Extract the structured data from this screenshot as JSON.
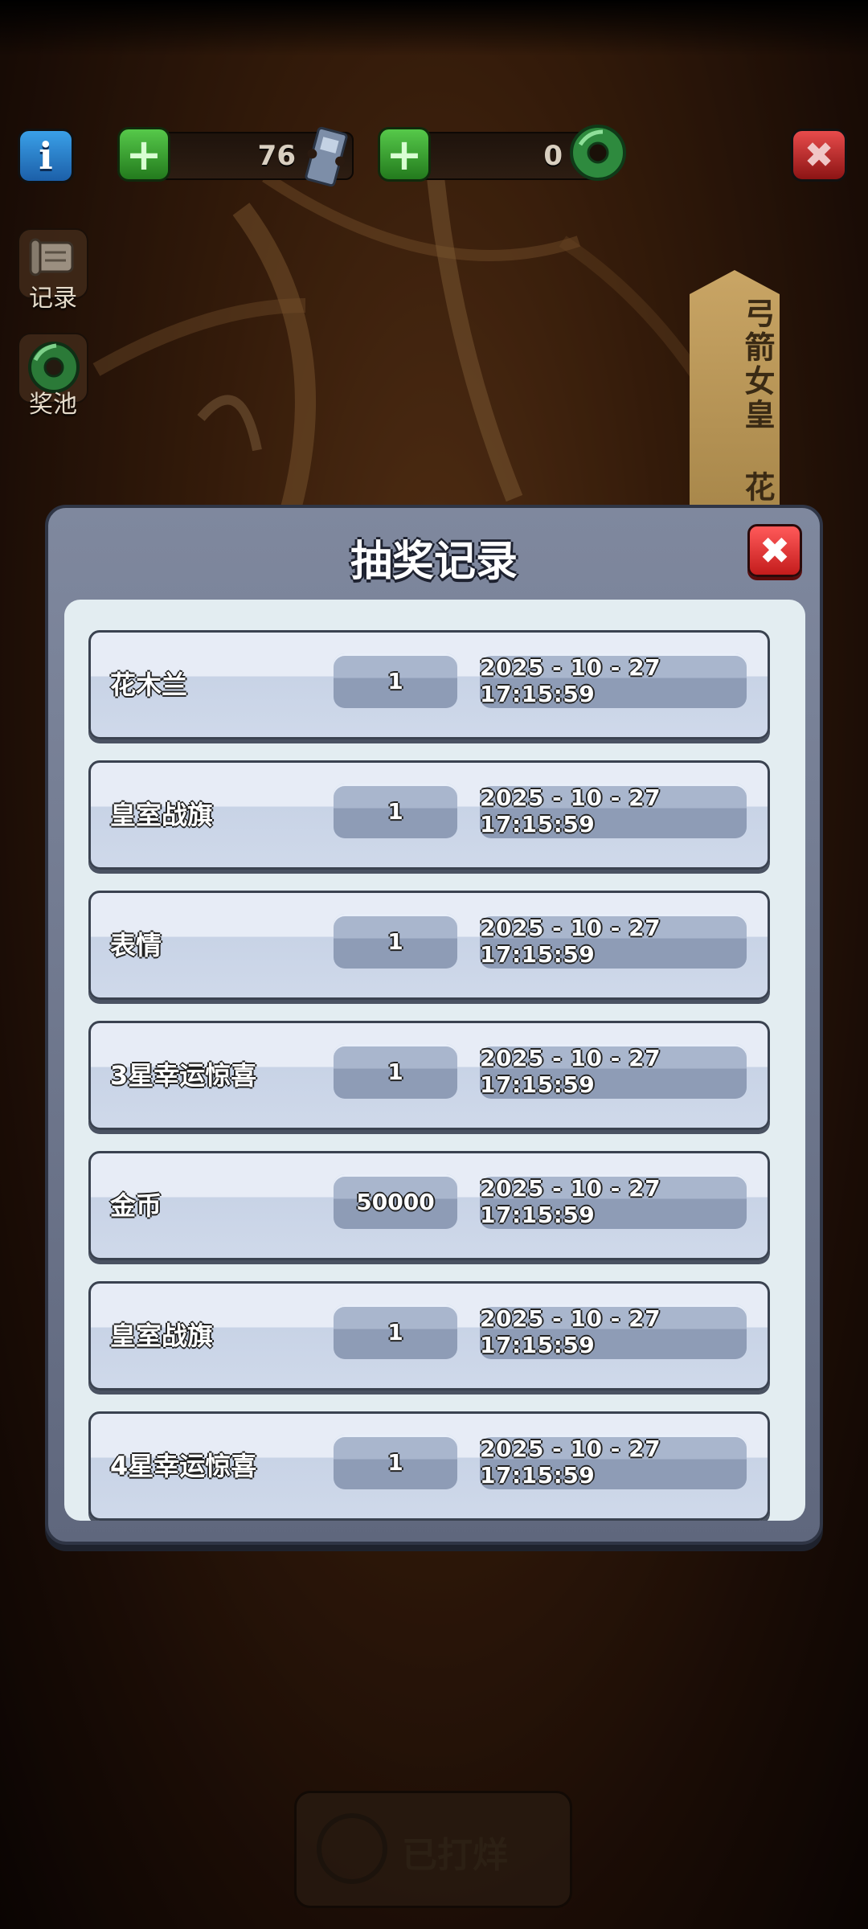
{
  "hud": {
    "tickets": "76",
    "jade": "0",
    "info_label": "i",
    "close_label": "✖"
  },
  "sidebar": {
    "records_label": "记录",
    "pool_label": "奖池"
  },
  "banner_text": "弓箭女皇 花",
  "bottom_button_label": "已打烊",
  "modal": {
    "title": "抽奖记录",
    "close_label": "✖",
    "rows": [
      {
        "name": "花木兰",
        "count": "1",
        "time": "2025 - 10 - 27  17:15:59"
      },
      {
        "name": "皇室战旗",
        "count": "1",
        "time": "2025 - 10 - 27  17:15:59"
      },
      {
        "name": "表情",
        "count": "1",
        "time": "2025 - 10 - 27  17:15:59"
      },
      {
        "name": "3星幸运惊喜",
        "count": "1",
        "time": "2025 - 10 - 27  17:15:59"
      },
      {
        "name": "金币",
        "count": "50000",
        "time": "2025 - 10 - 27  17:15:59"
      },
      {
        "name": "皇室战旗",
        "count": "1",
        "time": "2025 - 10 - 27  17:15:59"
      },
      {
        "name": "4星幸运惊喜",
        "count": "1",
        "time": "2025 - 10 - 27  17:15:59"
      }
    ]
  },
  "colors": {
    "modal_frame": "#6f788e",
    "modal_inner": "#e3edf1",
    "close_red": "#e03030",
    "plus_green": "#3aa838",
    "info_blue": "#2a7fd0"
  }
}
